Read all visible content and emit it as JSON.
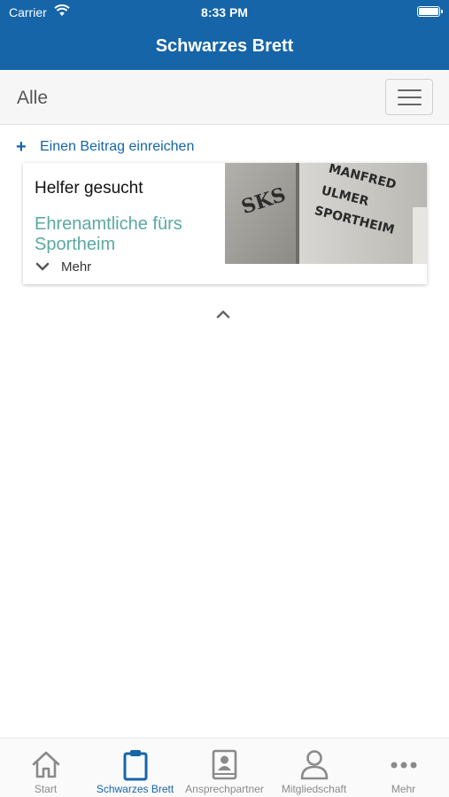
{
  "status_bar": {
    "carrier": "Carrier",
    "time": "8:33 PM"
  },
  "nav": {
    "title": "Schwarzes Brett"
  },
  "filter": {
    "label": "Alle"
  },
  "submit_link": {
    "label": "Einen Beitrag einreichen"
  },
  "posts": [
    {
      "title": "Helfer gesucht",
      "subtitle": "Ehrenamtliche fürs Sportheim",
      "more_label": "Mehr",
      "image_sign_text": [
        "MANFRED",
        "ULMER",
        "SPORTHEIM"
      ],
      "image_logo_text": "SKS"
    }
  ],
  "tabs": [
    {
      "label": "Start",
      "icon": "home-icon"
    },
    {
      "label": "Schwarzes Brett",
      "icon": "clipboard-icon",
      "active": true
    },
    {
      "label": "Ansprechpartner",
      "icon": "contact-book-icon"
    },
    {
      "label": "Mitgliedschaft",
      "icon": "person-icon"
    },
    {
      "label": "Mehr",
      "icon": "more-dots-icon"
    }
  ],
  "colors": {
    "brand": "#1565a8",
    "accent_text": "#5aa9a0",
    "tab_inactive": "#8a8a8a"
  }
}
